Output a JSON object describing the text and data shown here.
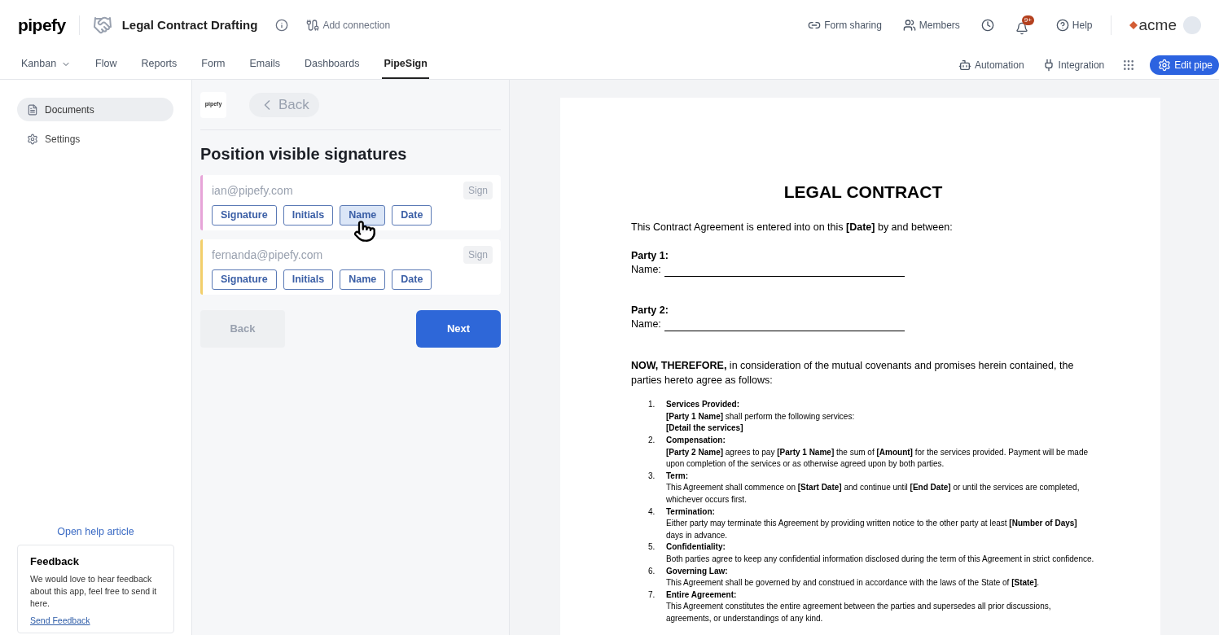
{
  "header": {
    "logo": "pipefy",
    "pipe_title": "Legal Contract Drafting",
    "add_connection": "Add connection",
    "actions": [
      {
        "kind": "link",
        "label": "Form sharing"
      },
      {
        "kind": "members",
        "label": "Members"
      },
      {
        "kind": "history"
      },
      {
        "kind": "bell",
        "badge": "9+"
      },
      {
        "kind": "help",
        "label": "Help"
      }
    ],
    "brand": "acme"
  },
  "tabs": [
    {
      "label": "Kanban",
      "selected": false,
      "dropdown": true
    },
    {
      "label": "Flow",
      "selected": false
    },
    {
      "label": "Reports",
      "selected": false
    },
    {
      "label": "Form",
      "selected": false
    },
    {
      "label": "Emails",
      "selected": false
    },
    {
      "label": "Dashboards",
      "selected": false
    },
    {
      "label": "PipeSign",
      "selected": true
    }
  ],
  "toolbar": [
    {
      "kind": "automation",
      "label": "Automation"
    },
    {
      "kind": "integration",
      "label": "Integration"
    },
    {
      "kind": "apps"
    },
    {
      "kind": "edit",
      "label": "Edit pipe"
    }
  ],
  "sidebar": {
    "items": [
      {
        "kind": "documents",
        "label": "Documents",
        "selected": true
      },
      {
        "kind": "settings",
        "label": "Settings",
        "selected": false
      }
    ],
    "help_link": "Open help article",
    "feedback": {
      "title": "Feedback",
      "text": "We would love to hear feedback about this app, feel free to send it here.",
      "link": "Send Feedback"
    }
  },
  "panel": {
    "logo": "pipefy",
    "back_top": "Back",
    "title": "Position visible signatures",
    "signers": [
      {
        "email": "ian@pipefy.com",
        "color": "#e7a4d8",
        "sign": "Sign",
        "fields": [
          {
            "label": "Signature",
            "selected": false
          },
          {
            "label": "Initials",
            "selected": false
          },
          {
            "label": "Name",
            "selected": true
          },
          {
            "label": "Date",
            "selected": false
          }
        ]
      },
      {
        "email": "fernanda@pipefy.com",
        "color": "#f2cf6b",
        "sign": "Sign",
        "fields": [
          {
            "label": "Signature",
            "selected": false
          },
          {
            "label": "Initials",
            "selected": false
          },
          {
            "label": "Name",
            "selected": false
          },
          {
            "label": "Date",
            "selected": false
          }
        ]
      }
    ],
    "back": "Back",
    "next": "Next"
  },
  "document": {
    "title": "LEGAL CONTRACT",
    "intro": "This Contract Agreement is entered into on this **[Date]** by and between:",
    "parties": [
      {
        "label": "Party 1:",
        "name_label": "Name:"
      },
      {
        "label": "Party 2:",
        "name_label": "Name:"
      }
    ],
    "whereas": "**NOW, THEREFORE,** in consideration of the mutual covenants and promises herein contained, the parties hereto agree as follows:",
    "items": [
      {
        "number": "1.",
        "title": "Services Provided:",
        "lines": [
          "**[Party 1 Name]** shall perform the following services:",
          "**[Detail the services]**"
        ]
      },
      {
        "number": "2.",
        "title": "Compensation:",
        "lines": [
          "**[Party 2 Name]** agrees to pay **[Party 1 Name]** the sum of **[Amount]** for the services provided. Payment will be made upon completion of the services or as otherwise agreed upon by both parties."
        ]
      },
      {
        "number": "3.",
        "title": "Term:",
        "lines": [
          "This Agreement shall commence on **[Start Date]** and continue until **[End Date]** or until the services are completed, whichever occurs first."
        ]
      },
      {
        "number": "4.",
        "title": "Termination:",
        "lines": [
          "Either party may terminate this Agreement by providing written notice to the other party at least **[Number of Days]** days in advance."
        ]
      },
      {
        "number": "5.",
        "title": "Confidentiality:",
        "lines": [
          "Both parties agree to keep any confidential information disclosed during the term of this Agreement in strict confidence."
        ]
      },
      {
        "number": "6.",
        "title": "Governing Law:",
        "lines": [
          "This Agreement shall be governed by and construed in accordance with the laws of the State of **[State]**."
        ]
      },
      {
        "number": "7.",
        "title": "Entire Agreement:",
        "lines": [
          "This Agreement constitutes the entire agreement between the parties and supersedes all prior discussions, agreements, or understandings of any kind."
        ]
      }
    ]
  }
}
